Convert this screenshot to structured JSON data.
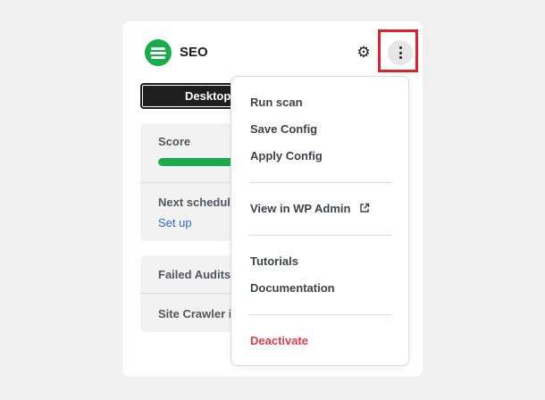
{
  "header": {
    "title": "SEO",
    "logo_icon": "seo-logo-icon",
    "settings_icon": "gear-icon",
    "more_icon": "more-vertical-icon"
  },
  "device_toggle": {
    "selected_label": "Desktop"
  },
  "summary": {
    "score_label": "Score",
    "score_progress": 1.0,
    "next_scheduled_label": "Next schedule",
    "setup_link": "Set up",
    "failed_audits_label": "Failed Audits",
    "site_crawler_label": "Site Crawler is"
  },
  "menu": {
    "items": [
      {
        "label": "Run scan"
      },
      {
        "label": "Save Config"
      },
      {
        "label": "Apply Config"
      },
      {
        "label": "View in WP Admin",
        "icon": "external-link-icon"
      },
      {
        "label": "Tutorials"
      },
      {
        "label": "Documentation"
      },
      {
        "label": "Deactivate",
        "style": "danger"
      }
    ]
  },
  "colors": {
    "brand_green": "#1aab4c",
    "danger_red": "#e63946",
    "link_blue": "#2c6bd9",
    "highlight_red": "#e0202a"
  }
}
